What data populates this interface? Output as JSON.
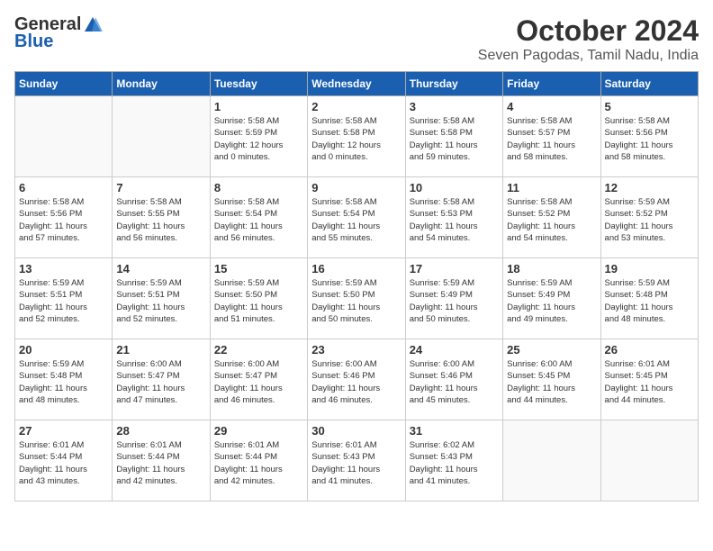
{
  "header": {
    "logo_general": "General",
    "logo_blue": "Blue",
    "month_title": "October 2024",
    "location": "Seven Pagodas, Tamil Nadu, India"
  },
  "weekdays": [
    "Sunday",
    "Monday",
    "Tuesday",
    "Wednesday",
    "Thursday",
    "Friday",
    "Saturday"
  ],
  "weeks": [
    [
      {
        "day": "",
        "info": ""
      },
      {
        "day": "",
        "info": ""
      },
      {
        "day": "1",
        "info": "Sunrise: 5:58 AM\nSunset: 5:59 PM\nDaylight: 12 hours\nand 0 minutes."
      },
      {
        "day": "2",
        "info": "Sunrise: 5:58 AM\nSunset: 5:58 PM\nDaylight: 12 hours\nand 0 minutes."
      },
      {
        "day": "3",
        "info": "Sunrise: 5:58 AM\nSunset: 5:58 PM\nDaylight: 11 hours\nand 59 minutes."
      },
      {
        "day": "4",
        "info": "Sunrise: 5:58 AM\nSunset: 5:57 PM\nDaylight: 11 hours\nand 58 minutes."
      },
      {
        "day": "5",
        "info": "Sunrise: 5:58 AM\nSunset: 5:56 PM\nDaylight: 11 hours\nand 58 minutes."
      }
    ],
    [
      {
        "day": "6",
        "info": "Sunrise: 5:58 AM\nSunset: 5:56 PM\nDaylight: 11 hours\nand 57 minutes."
      },
      {
        "day": "7",
        "info": "Sunrise: 5:58 AM\nSunset: 5:55 PM\nDaylight: 11 hours\nand 56 minutes."
      },
      {
        "day": "8",
        "info": "Sunrise: 5:58 AM\nSunset: 5:54 PM\nDaylight: 11 hours\nand 56 minutes."
      },
      {
        "day": "9",
        "info": "Sunrise: 5:58 AM\nSunset: 5:54 PM\nDaylight: 11 hours\nand 55 minutes."
      },
      {
        "day": "10",
        "info": "Sunrise: 5:58 AM\nSunset: 5:53 PM\nDaylight: 11 hours\nand 54 minutes."
      },
      {
        "day": "11",
        "info": "Sunrise: 5:58 AM\nSunset: 5:52 PM\nDaylight: 11 hours\nand 54 minutes."
      },
      {
        "day": "12",
        "info": "Sunrise: 5:59 AM\nSunset: 5:52 PM\nDaylight: 11 hours\nand 53 minutes."
      }
    ],
    [
      {
        "day": "13",
        "info": "Sunrise: 5:59 AM\nSunset: 5:51 PM\nDaylight: 11 hours\nand 52 minutes."
      },
      {
        "day": "14",
        "info": "Sunrise: 5:59 AM\nSunset: 5:51 PM\nDaylight: 11 hours\nand 52 minutes."
      },
      {
        "day": "15",
        "info": "Sunrise: 5:59 AM\nSunset: 5:50 PM\nDaylight: 11 hours\nand 51 minutes."
      },
      {
        "day": "16",
        "info": "Sunrise: 5:59 AM\nSunset: 5:50 PM\nDaylight: 11 hours\nand 50 minutes."
      },
      {
        "day": "17",
        "info": "Sunrise: 5:59 AM\nSunset: 5:49 PM\nDaylight: 11 hours\nand 50 minutes."
      },
      {
        "day": "18",
        "info": "Sunrise: 5:59 AM\nSunset: 5:49 PM\nDaylight: 11 hours\nand 49 minutes."
      },
      {
        "day": "19",
        "info": "Sunrise: 5:59 AM\nSunset: 5:48 PM\nDaylight: 11 hours\nand 48 minutes."
      }
    ],
    [
      {
        "day": "20",
        "info": "Sunrise: 5:59 AM\nSunset: 5:48 PM\nDaylight: 11 hours\nand 48 minutes."
      },
      {
        "day": "21",
        "info": "Sunrise: 6:00 AM\nSunset: 5:47 PM\nDaylight: 11 hours\nand 47 minutes."
      },
      {
        "day": "22",
        "info": "Sunrise: 6:00 AM\nSunset: 5:47 PM\nDaylight: 11 hours\nand 46 minutes."
      },
      {
        "day": "23",
        "info": "Sunrise: 6:00 AM\nSunset: 5:46 PM\nDaylight: 11 hours\nand 46 minutes."
      },
      {
        "day": "24",
        "info": "Sunrise: 6:00 AM\nSunset: 5:46 PM\nDaylight: 11 hours\nand 45 minutes."
      },
      {
        "day": "25",
        "info": "Sunrise: 6:00 AM\nSunset: 5:45 PM\nDaylight: 11 hours\nand 44 minutes."
      },
      {
        "day": "26",
        "info": "Sunrise: 6:01 AM\nSunset: 5:45 PM\nDaylight: 11 hours\nand 44 minutes."
      }
    ],
    [
      {
        "day": "27",
        "info": "Sunrise: 6:01 AM\nSunset: 5:44 PM\nDaylight: 11 hours\nand 43 minutes."
      },
      {
        "day": "28",
        "info": "Sunrise: 6:01 AM\nSunset: 5:44 PM\nDaylight: 11 hours\nand 42 minutes."
      },
      {
        "day": "29",
        "info": "Sunrise: 6:01 AM\nSunset: 5:44 PM\nDaylight: 11 hours\nand 42 minutes."
      },
      {
        "day": "30",
        "info": "Sunrise: 6:01 AM\nSunset: 5:43 PM\nDaylight: 11 hours\nand 41 minutes."
      },
      {
        "day": "31",
        "info": "Sunrise: 6:02 AM\nSunset: 5:43 PM\nDaylight: 11 hours\nand 41 minutes."
      },
      {
        "day": "",
        "info": ""
      },
      {
        "day": "",
        "info": ""
      }
    ]
  ]
}
